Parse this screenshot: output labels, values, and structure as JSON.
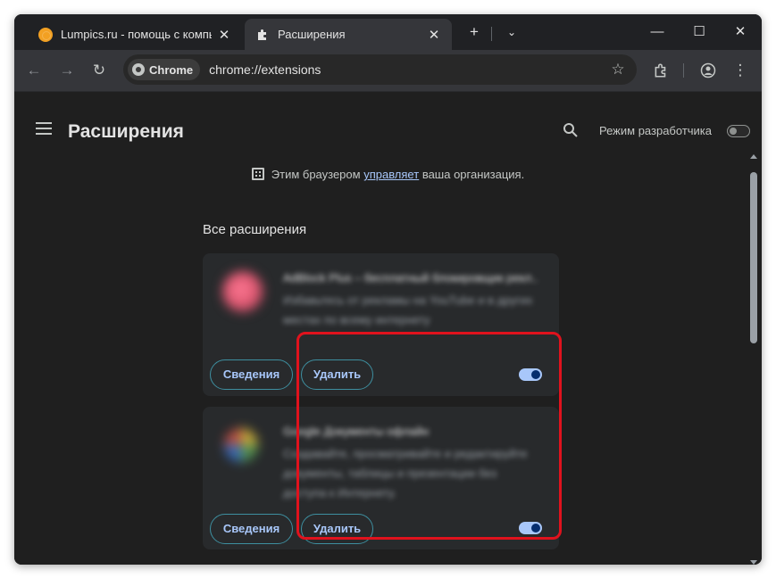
{
  "tabs": [
    {
      "title": "Lumpics.ru - помощь с компь",
      "icon": "orange-icon"
    },
    {
      "title": "Расширения",
      "icon": "puzzle-icon"
    }
  ],
  "address": {
    "chip_label": "Chrome",
    "url": "chrome://extensions"
  },
  "page": {
    "title": "Расширения",
    "developer_mode_label": "Режим разработчика",
    "developer_mode_on": false,
    "managed_prefix": "Этим браузером ",
    "managed_link": "управляет",
    "managed_suffix": " ваша организация.",
    "section_title": "Все расширения"
  },
  "extensions": [
    {
      "name": "AdBlock Plus – бесплатный блокировщик рекл...",
      "description": "Избавьтесь от рекламы на YouTube и в других местах по всему интернету",
      "details_label": "Сведения",
      "remove_label": "Удалить",
      "enabled": true
    },
    {
      "name": "Google Документы офлайн",
      "description": "Создавайте, просматривайте и редактируйте документы, таблицы и презентации без доступа к Интернету.",
      "details_label": "Сведения",
      "remove_label": "Удалить",
      "enabled": true
    }
  ],
  "colors": {
    "highlight": "#e0121d",
    "accent": "#a8c7fa"
  }
}
